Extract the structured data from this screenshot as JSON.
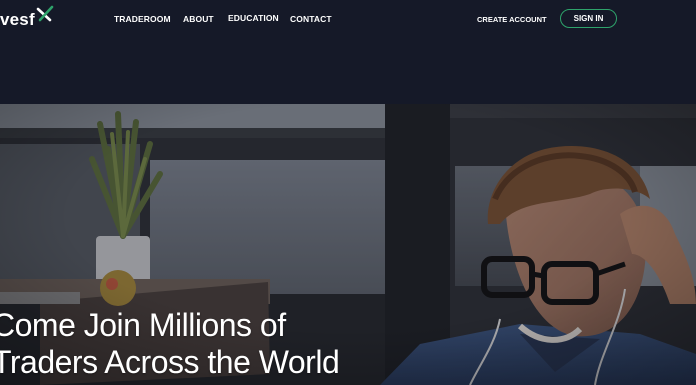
{
  "header": {
    "brand": "vesf",
    "brand_mark": "x-mark-icon",
    "nav": {
      "traderoom": "TRADEROOM",
      "about": "ABOUT",
      "education": "EDUCATION",
      "contact": "CONTACT"
    },
    "create_account": "CREATE ACCOUNT",
    "sign_in": "SIGN IN"
  },
  "hero": {
    "title_line1": "Come Join Millions of",
    "title_line2": "Traders Across the World"
  },
  "colors": {
    "nav_background": "#151928",
    "accent_green": "#2ea36b",
    "text": "#ffffff"
  }
}
